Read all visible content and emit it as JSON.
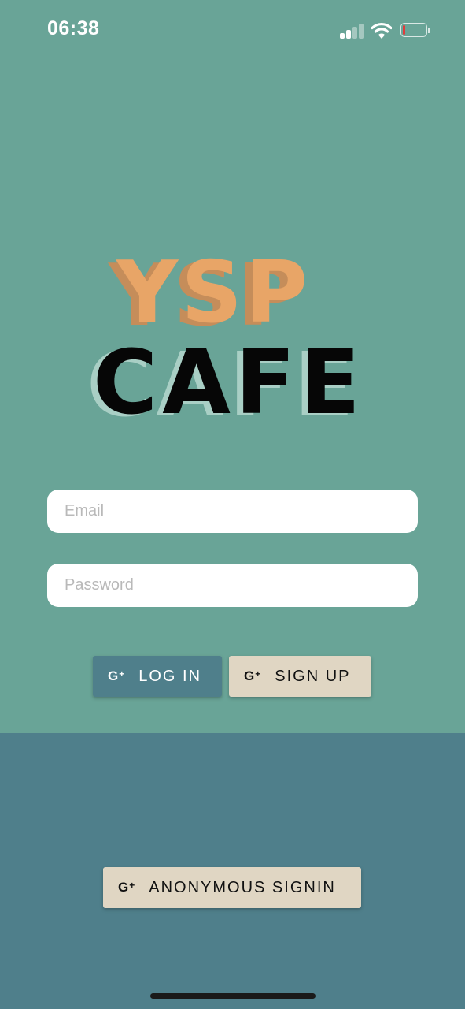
{
  "status_bar": {
    "time": "06:38",
    "signal_icon": "cellular-signal-icon",
    "wifi_icon": "wifi-icon",
    "battery_icon": "battery-low-icon",
    "battery_level": 0.12
  },
  "logo": {
    "line1": "YSP",
    "line2": "CAFE"
  },
  "form": {
    "email_placeholder": "Email",
    "email_value": "",
    "password_placeholder": "Password",
    "password_value": ""
  },
  "buttons": {
    "login_label": "LOG IN",
    "signup_label": "SIGN UP",
    "anonymous_label": "ANONYMOUS SIGNIN",
    "icon": "google-plus-icon",
    "icon_text": "G",
    "icon_plus": "+"
  },
  "colors": {
    "top_background": "#69a497",
    "bottom_background": "#4f7f8b",
    "logo_accent": "#e8a567",
    "login_button": "#4f7f8b",
    "secondary_button": "#e0d6c3",
    "battery_low": "#e23b3b"
  }
}
